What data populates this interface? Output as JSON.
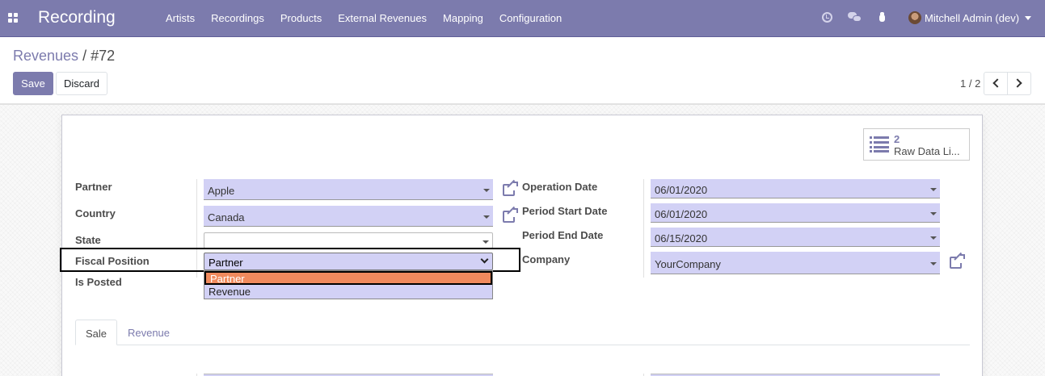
{
  "app": {
    "title": "Recording"
  },
  "nav": {
    "menu": [
      "Artists",
      "Recordings",
      "Products",
      "External Revenues",
      "Mapping",
      "Configuration"
    ],
    "user": "Mitchell Admin (dev)",
    "icons": [
      "apps-icon",
      "clock-icon",
      "chat-icon",
      "bug-icon"
    ]
  },
  "breadcrumb": {
    "parent": "Revenues",
    "separator": "/",
    "current": "#72"
  },
  "actions": {
    "save": "Save",
    "discard": "Discard"
  },
  "pager": {
    "value": "1 / 2"
  },
  "smart_button": {
    "count": "2",
    "label": "Raw Data Li..."
  },
  "form": {
    "partner": {
      "label": "Partner",
      "value": "Apple"
    },
    "country": {
      "label": "Country",
      "value": "Canada"
    },
    "state": {
      "label": "State",
      "value": ""
    },
    "fiscal_position": {
      "label": "Fiscal Position",
      "value": "Partner",
      "options": [
        "Partner",
        "Revenue"
      ],
      "highlighted": "Partner"
    },
    "is_posted": {
      "label": "Is Posted"
    },
    "operation_date": {
      "label": "Operation Date",
      "value": "06/01/2020"
    },
    "period_start": {
      "label": "Period Start Date",
      "value": "06/01/2020"
    },
    "period_end": {
      "label": "Period End Date",
      "value": "06/15/2020"
    },
    "company": {
      "label": "Company",
      "value": "YourCompany"
    }
  },
  "tabs": [
    "Sale",
    "Revenue"
  ],
  "colors": {
    "brand": "#7c7bad",
    "field_bg": "#d2d1f5",
    "option_highlight": "#f08a5d"
  }
}
